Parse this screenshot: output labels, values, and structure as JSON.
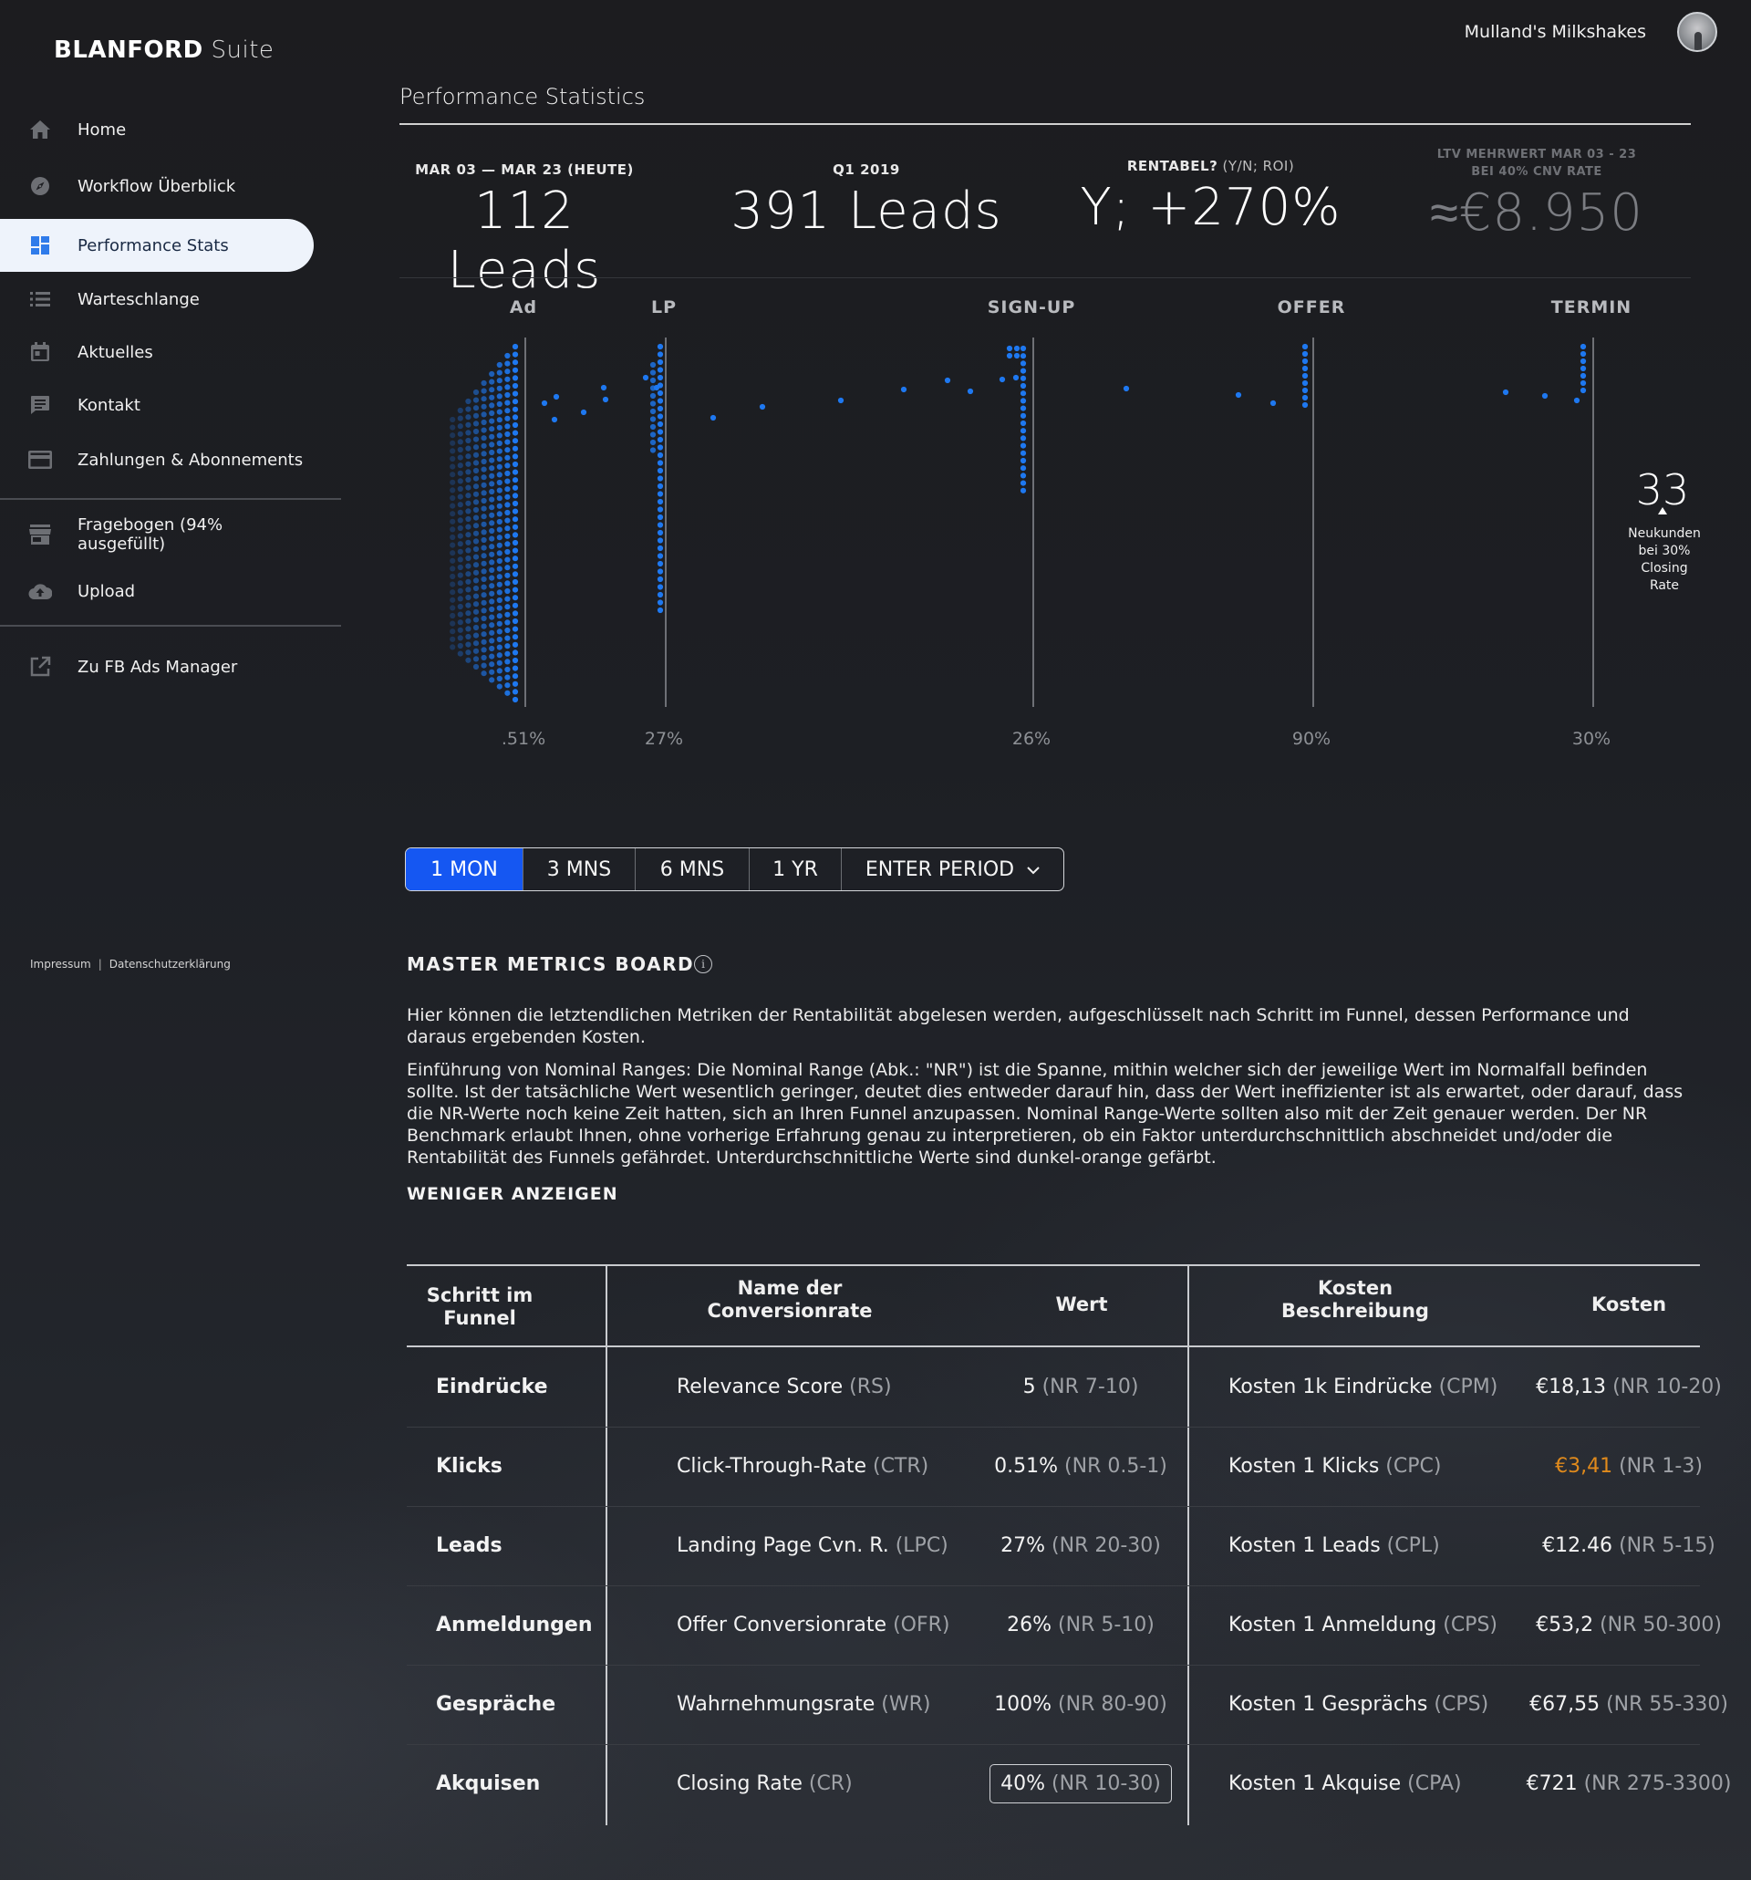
{
  "brand": {
    "name": "BLANFORD",
    "suffix": "Suite"
  },
  "header": {
    "account_name": "Mulland's Milkshakes"
  },
  "sidebar": {
    "items": [
      {
        "label": "Home",
        "icon": "home-icon"
      },
      {
        "label": "Workflow Überblick",
        "icon": "compass-icon"
      },
      {
        "label": "Performance Stats",
        "icon": "dashboard-icon",
        "active": true
      },
      {
        "label": "Warteschlange",
        "icon": "list-icon"
      },
      {
        "label": "Aktuelles",
        "icon": "calendar-icon"
      },
      {
        "label": "Kontakt",
        "icon": "chat-icon"
      },
      {
        "label": "Zahlungen & Abonnements",
        "icon": "credit-card-icon"
      },
      {
        "label": "Fragebogen (94% ausgefüllt)",
        "icon": "store-icon"
      },
      {
        "label": "Upload",
        "icon": "cloud-upload-icon"
      },
      {
        "label": "Zu FB Ads Manager",
        "icon": "external-link-icon"
      }
    ],
    "footer": {
      "impressum": "Impressum",
      "separator": "|",
      "privacy": "Datenschutzerklärung"
    }
  },
  "page": {
    "title": "Performance Statistics"
  },
  "kpis": [
    {
      "label": "MAR 03 — MAR 23 (HEUTE)",
      "label_light": "",
      "value": "112 Leads"
    },
    {
      "label": "Q1 2019",
      "label_light": "",
      "value": "391 Leads"
    },
    {
      "label": "RENTABEL?",
      "label_light": " (Y/N; ROI)",
      "value": "Y; +270%"
    },
    {
      "label": "LTV MEHRWERT MAR 03 - 23",
      "label2": "BEI 40% CNV RATE",
      "value": "≈€8.950"
    }
  ],
  "chart_data": {
    "type": "funnel",
    "stages": [
      "Ad",
      "LP",
      "SIGN-UP",
      "OFFER",
      "TERMIN"
    ],
    "conversion_rates": [
      ".51%",
      "27%",
      "26%",
      "90%",
      "30%"
    ],
    "dot_color": "#1e78f0",
    "result": {
      "value": "33",
      "note": [
        "Neukunden",
        "bei 30%",
        "Closing",
        "Rate"
      ]
    }
  },
  "periods": {
    "options": [
      "1 MON",
      "3 MNS",
      "6 MNS",
      "1 YR",
      "ENTER PERIOD"
    ],
    "active": "1 MON",
    "accent": "#1557f2"
  },
  "metrics_board": {
    "title": "MASTER METRICS BOARD",
    "paragraph1": "Hier können die letztendlichen Metriken der Rentabilität abgelesen werden, aufgeschlüsselt nach Schritt im Funnel, dessen Performance und daraus ergebenden Kosten.",
    "paragraph2": "Einführung von Nominal Ranges: Die Nominal Range (Abk.: \"NR\") ist die Spanne, mithin welcher sich der jeweilige Wert im Normalfall befinden sollte. Ist der tatsächliche Wert wesentlich geringer, deutet dies entweder darauf hin, dass der Wert ineffizienter ist als erwartet, oder darauf, dass die NR-Werte noch keine Zeit hatten, sich an Ihren Funnel anzupassen. Nominal Range-Werte sollten also mit der Zeit genauer werden. Der NR Benchmark erlaubt Ihnen, ohne vorherige Erfahrung genau zu interpretieren, ob ein Faktor unterdurchschnittlich abschneidet und/oder die Rentabilität des Funnels gefährdet. Unterdurchschnittliche Werte sind dunkel-orange gefärbt.",
    "show_less": "WENIGER ANZEIGEN",
    "warning_color": "#e08a1c"
  },
  "table": {
    "headers": {
      "step": [
        "Schritt im",
        "Funnel"
      ],
      "name": [
        "Name der",
        "Conversionrate"
      ],
      "wert": "Wert",
      "kdesc": [
        "Kosten",
        "Beschreibung"
      ],
      "kost": "Kosten"
    },
    "rows": [
      {
        "step": "Eindrücke",
        "name": "Relevance Score",
        "abbr": "(RS)",
        "wert": "5",
        "wert_nr": "(NR 7-10)",
        "kdesc": "Kosten 1k Eindrücke",
        "kabbr": "(CPM)",
        "kost": "€18,13",
        "kost_nr": "(NR 10-20)",
        "kost_warn": false,
        "boxed": false
      },
      {
        "step": "Klicks",
        "name": "Click-Through-Rate",
        "abbr": "(CTR)",
        "wert": "0.51%",
        "wert_nr": "(NR 0.5-1)",
        "kdesc": "Kosten 1 Klicks",
        "kabbr": "(CPC)",
        "kost": "€3,41",
        "kost_nr": "(NR 1-3)",
        "kost_warn": true,
        "boxed": false
      },
      {
        "step": "Leads",
        "name": "Landing Page Cvn. R.",
        "abbr": "(LPC)",
        "wert": "27%",
        "wert_nr": "(NR 20-30)",
        "kdesc": "Kosten 1 Leads",
        "kabbr": "(CPL)",
        "kost": "€12.46",
        "kost_nr": "(NR 5-15)",
        "kost_warn": false,
        "boxed": false
      },
      {
        "step": "Anmeldungen",
        "name": "Offer Conversionrate",
        "abbr": "(OFR)",
        "wert": "26%",
        "wert_nr": "(NR 5-10)",
        "kdesc": "Kosten 1 Anmeldung",
        "kabbr": "(CPS)",
        "kost": "€53,2",
        "kost_nr": "(NR 50-300)",
        "kost_warn": false,
        "boxed": false
      },
      {
        "step": "Gespräche",
        "name": "Wahrnehmungsrate",
        "abbr": "(WR)",
        "wert": "100%",
        "wert_nr": "(NR 80-90)",
        "kdesc": "Kosten 1 Gesprächs",
        "kabbr": "(CPS)",
        "kost": "€67,55",
        "kost_nr": "(NR 55-330)",
        "kost_warn": false,
        "boxed": false
      },
      {
        "step": "Akquisen",
        "name": "Closing Rate",
        "abbr": "(CR)",
        "wert": "40%",
        "wert_nr": "(NR 10-30)",
        "kdesc": "Kosten 1 Akquise",
        "kabbr": "(CPA)",
        "kost": "€721",
        "kost_nr": "(NR 275-3300)",
        "kost_warn": false,
        "boxed": true
      }
    ]
  }
}
